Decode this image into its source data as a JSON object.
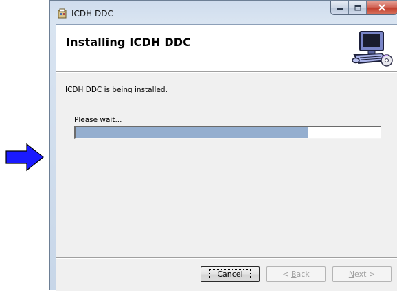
{
  "window": {
    "title": "ICDH DDC",
    "buttons": {
      "minimize_icon": "minimize-icon",
      "maximize_icon": "maximize-icon",
      "close_icon": "close-icon"
    }
  },
  "banner": {
    "title": "Installing ICDH DDC",
    "image_icon": "computer-install-icon"
  },
  "status": {
    "message": "ICDH DDC is being installed.",
    "wait_label": "Please wait...",
    "progress_fraction": 0.76
  },
  "footer": {
    "cancel_label": "Cancel",
    "back_prefix": "< ",
    "back_mnemonic": "B",
    "back_rest": "ack",
    "next_mnemonic": "N",
    "next_rest": "ext >"
  },
  "colors": {
    "progress_fill": "#94aecf",
    "arrow": "#1a1aff"
  },
  "decoration": {
    "arrow_icon": "blue-right-arrow-icon"
  }
}
